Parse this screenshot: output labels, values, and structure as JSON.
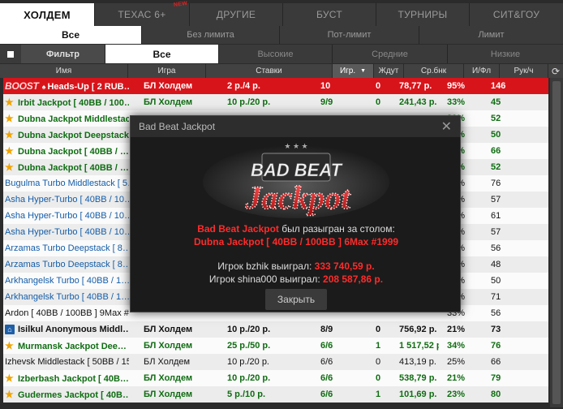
{
  "tabs1": [
    {
      "label": "ХОЛДЕМ",
      "active": true
    },
    {
      "label": "ТЕХАС 6+",
      "badge": "NEW"
    },
    {
      "label": "ДРУГИЕ"
    },
    {
      "label": "БУСТ"
    },
    {
      "label": "ТУРНИРЫ"
    },
    {
      "label": "СИТ&ГОУ"
    }
  ],
  "tabs2": [
    {
      "label": "Все",
      "active": true
    },
    {
      "label": "Без лимита"
    },
    {
      "label": "Пот-лимит"
    },
    {
      "label": "Лимит"
    }
  ],
  "tabs3": {
    "filter_label": "Фильтр",
    "items": [
      {
        "label": "Все",
        "active": true
      },
      {
        "label": "Высокие"
      },
      {
        "label": "Средние"
      },
      {
        "label": "Низкие"
      }
    ]
  },
  "columns": [
    "Имя",
    "Игра",
    "Ставки",
    "Игр.",
    "Ждут",
    "Ср.бнк",
    "И/Фл",
    "Рук/ч"
  ],
  "sorted_column": "Игр.",
  "rows": [
    {
      "type": "boost",
      "logo": "BOOST",
      "name": "Heads-Up [ 2 RUB…",
      "game": "БЛ Холдем",
      "stakes": "2 р./4 р.",
      "players": "10",
      "waiting": "0",
      "pot": "78,77 р.",
      "flop": "95%",
      "hands": "146"
    },
    {
      "type": "green",
      "star": true,
      "name": "Irbit Jackpot [ 40BB / 100…",
      "game": "БЛ Холдем",
      "stakes": "10 р./20 р.",
      "players": "9/9",
      "waiting": "0",
      "pot": "241,43 р.",
      "flop": "33%",
      "hands": "45"
    },
    {
      "type": "green",
      "star": true,
      "name": "Dubna Jackpot Middlestack",
      "game": "",
      "stakes": "",
      "players": "",
      "waiting": "",
      "pot": "",
      "flop": "20%",
      "hands": "52"
    },
    {
      "type": "green",
      "star": true,
      "name": "Dubna Jackpot Deepstack",
      "game": "",
      "stakes": "",
      "players": "",
      "waiting": "",
      "pot": "",
      "flop": "27%",
      "hands": "50"
    },
    {
      "type": "green",
      "star": true,
      "name": "Dubna Jackpot [ 40BB / …",
      "game": "",
      "stakes": "",
      "players": "",
      "waiting": "",
      "pot": "",
      "flop": "22%",
      "hands": "66"
    },
    {
      "type": "green",
      "star": true,
      "name": "Dubna Jackpot [ 40BB / …",
      "game": "",
      "stakes": "",
      "players": "",
      "waiting": "",
      "pot": "",
      "flop": "23%",
      "hands": "52"
    },
    {
      "type": "blue",
      "name": "Bugulma Turbo Middlestack [ 5…",
      "game": "",
      "stakes": "",
      "players": "",
      "waiting": "",
      "pot": "",
      "flop": "14%",
      "hands": "76"
    },
    {
      "type": "blue",
      "name": "Asha Hyper-Turbo [ 40BB / 10…",
      "game": "",
      "stakes": "",
      "players": "",
      "waiting": "",
      "pot": "",
      "flop": "35%",
      "hands": "57"
    },
    {
      "type": "blue",
      "name": "Asha Hyper-Turbo [ 40BB / 10…",
      "game": "",
      "stakes": "",
      "players": "",
      "waiting": "",
      "pot": "",
      "flop": "21%",
      "hands": "61"
    },
    {
      "type": "blue",
      "name": "Asha Hyper-Turbo [ 40BB / 10…",
      "game": "",
      "stakes": "",
      "players": "",
      "waiting": "",
      "pot": "",
      "flop": "38%",
      "hands": "57"
    },
    {
      "type": "blue",
      "name": "Arzamas Turbo Deepstack [ 8…",
      "game": "",
      "stakes": "",
      "players": "",
      "waiting": "",
      "pot": "",
      "flop": "34%",
      "hands": "56"
    },
    {
      "type": "blue",
      "name": "Arzamas Turbo Deepstack [ 8…",
      "game": "",
      "stakes": "",
      "players": "",
      "waiting": "",
      "pot": "",
      "flop": "29%",
      "hands": "48"
    },
    {
      "type": "blue",
      "name": "Arkhangelsk Turbo [ 40BB / 1…",
      "game": "",
      "stakes": "",
      "players": "",
      "waiting": "",
      "pot": "",
      "flop": "26%",
      "hands": "50"
    },
    {
      "type": "blue",
      "name": "Arkhangelsk Turbo [ 40BB / 1…",
      "game": "",
      "stakes": "",
      "players": "",
      "waiting": "",
      "pot": "",
      "flop": "67%",
      "hands": "71"
    },
    {
      "type": "black",
      "name": "Ardon [ 40BB / 100BB ] 9Max #…",
      "game": "",
      "stakes": "",
      "players": "",
      "waiting": "",
      "pot": "",
      "flop": "33%",
      "hands": "56"
    },
    {
      "type": "boldblack",
      "lock": true,
      "name": "Isilkul Anonymous Middl…",
      "game": "БЛ Холдем",
      "stakes": "10 р./20 р.",
      "players": "8/9",
      "waiting": "0",
      "pot": "756,92 р.",
      "flop": "21%",
      "hands": "73"
    },
    {
      "type": "green",
      "star": true,
      "name": "Murmansk Jackpot Dee…",
      "game": "БЛ Холдем",
      "stakes": "25 р./50 р.",
      "players": "6/6",
      "waiting": "1",
      "pot": "1 517,52 р.",
      "flop": "34%",
      "hands": "76"
    },
    {
      "type": "black",
      "name": "Izhevsk Middlestack [ 50BB / 15…",
      "game": "БЛ Холдем",
      "stakes": "10 р./20 р.",
      "players": "6/6",
      "waiting": "0",
      "pot": "413,19 р.",
      "flop": "25%",
      "hands": "66"
    },
    {
      "type": "green",
      "star": true,
      "name": "Izberbash Jackpot [ 40B…",
      "game": "БЛ Холдем",
      "stakes": "10 р./20 р.",
      "players": "6/6",
      "waiting": "0",
      "pot": "538,79 р.",
      "flop": "21%",
      "hands": "79"
    },
    {
      "type": "green",
      "star": true,
      "name": "Gudermes Jackpot [ 40B…",
      "game": "БЛ Холдем",
      "stakes": "5 р./10 р.",
      "players": "6/6",
      "waiting": "1",
      "pot": "101,69 р.",
      "flop": "23%",
      "hands": "80"
    }
  ],
  "modal": {
    "title": "Bad Beat Jackpot",
    "logo_top": "BAD BEAT",
    "logo_bottom": "Jackpot",
    "msg_strong": "Bad Beat Jackpot",
    "msg_rest": "был разыгран за столом:",
    "table_name": "Dubna Jackpot [ 40BB / 100BB ] 6Max #1999",
    "winner1_prefix": "Игрок bzhik выиграл:",
    "winner1_amount": "333 740,59 р.",
    "winner2_prefix": "Игрок shina000 выиграл:",
    "winner2_amount": "208 587,86 р.",
    "close_label": "Закрыть"
  },
  "colors": {
    "accent_red": "#d8141b",
    "jackpot_green": "#0f6d12",
    "link_blue": "#145da8",
    "star": "#f0a300"
  }
}
